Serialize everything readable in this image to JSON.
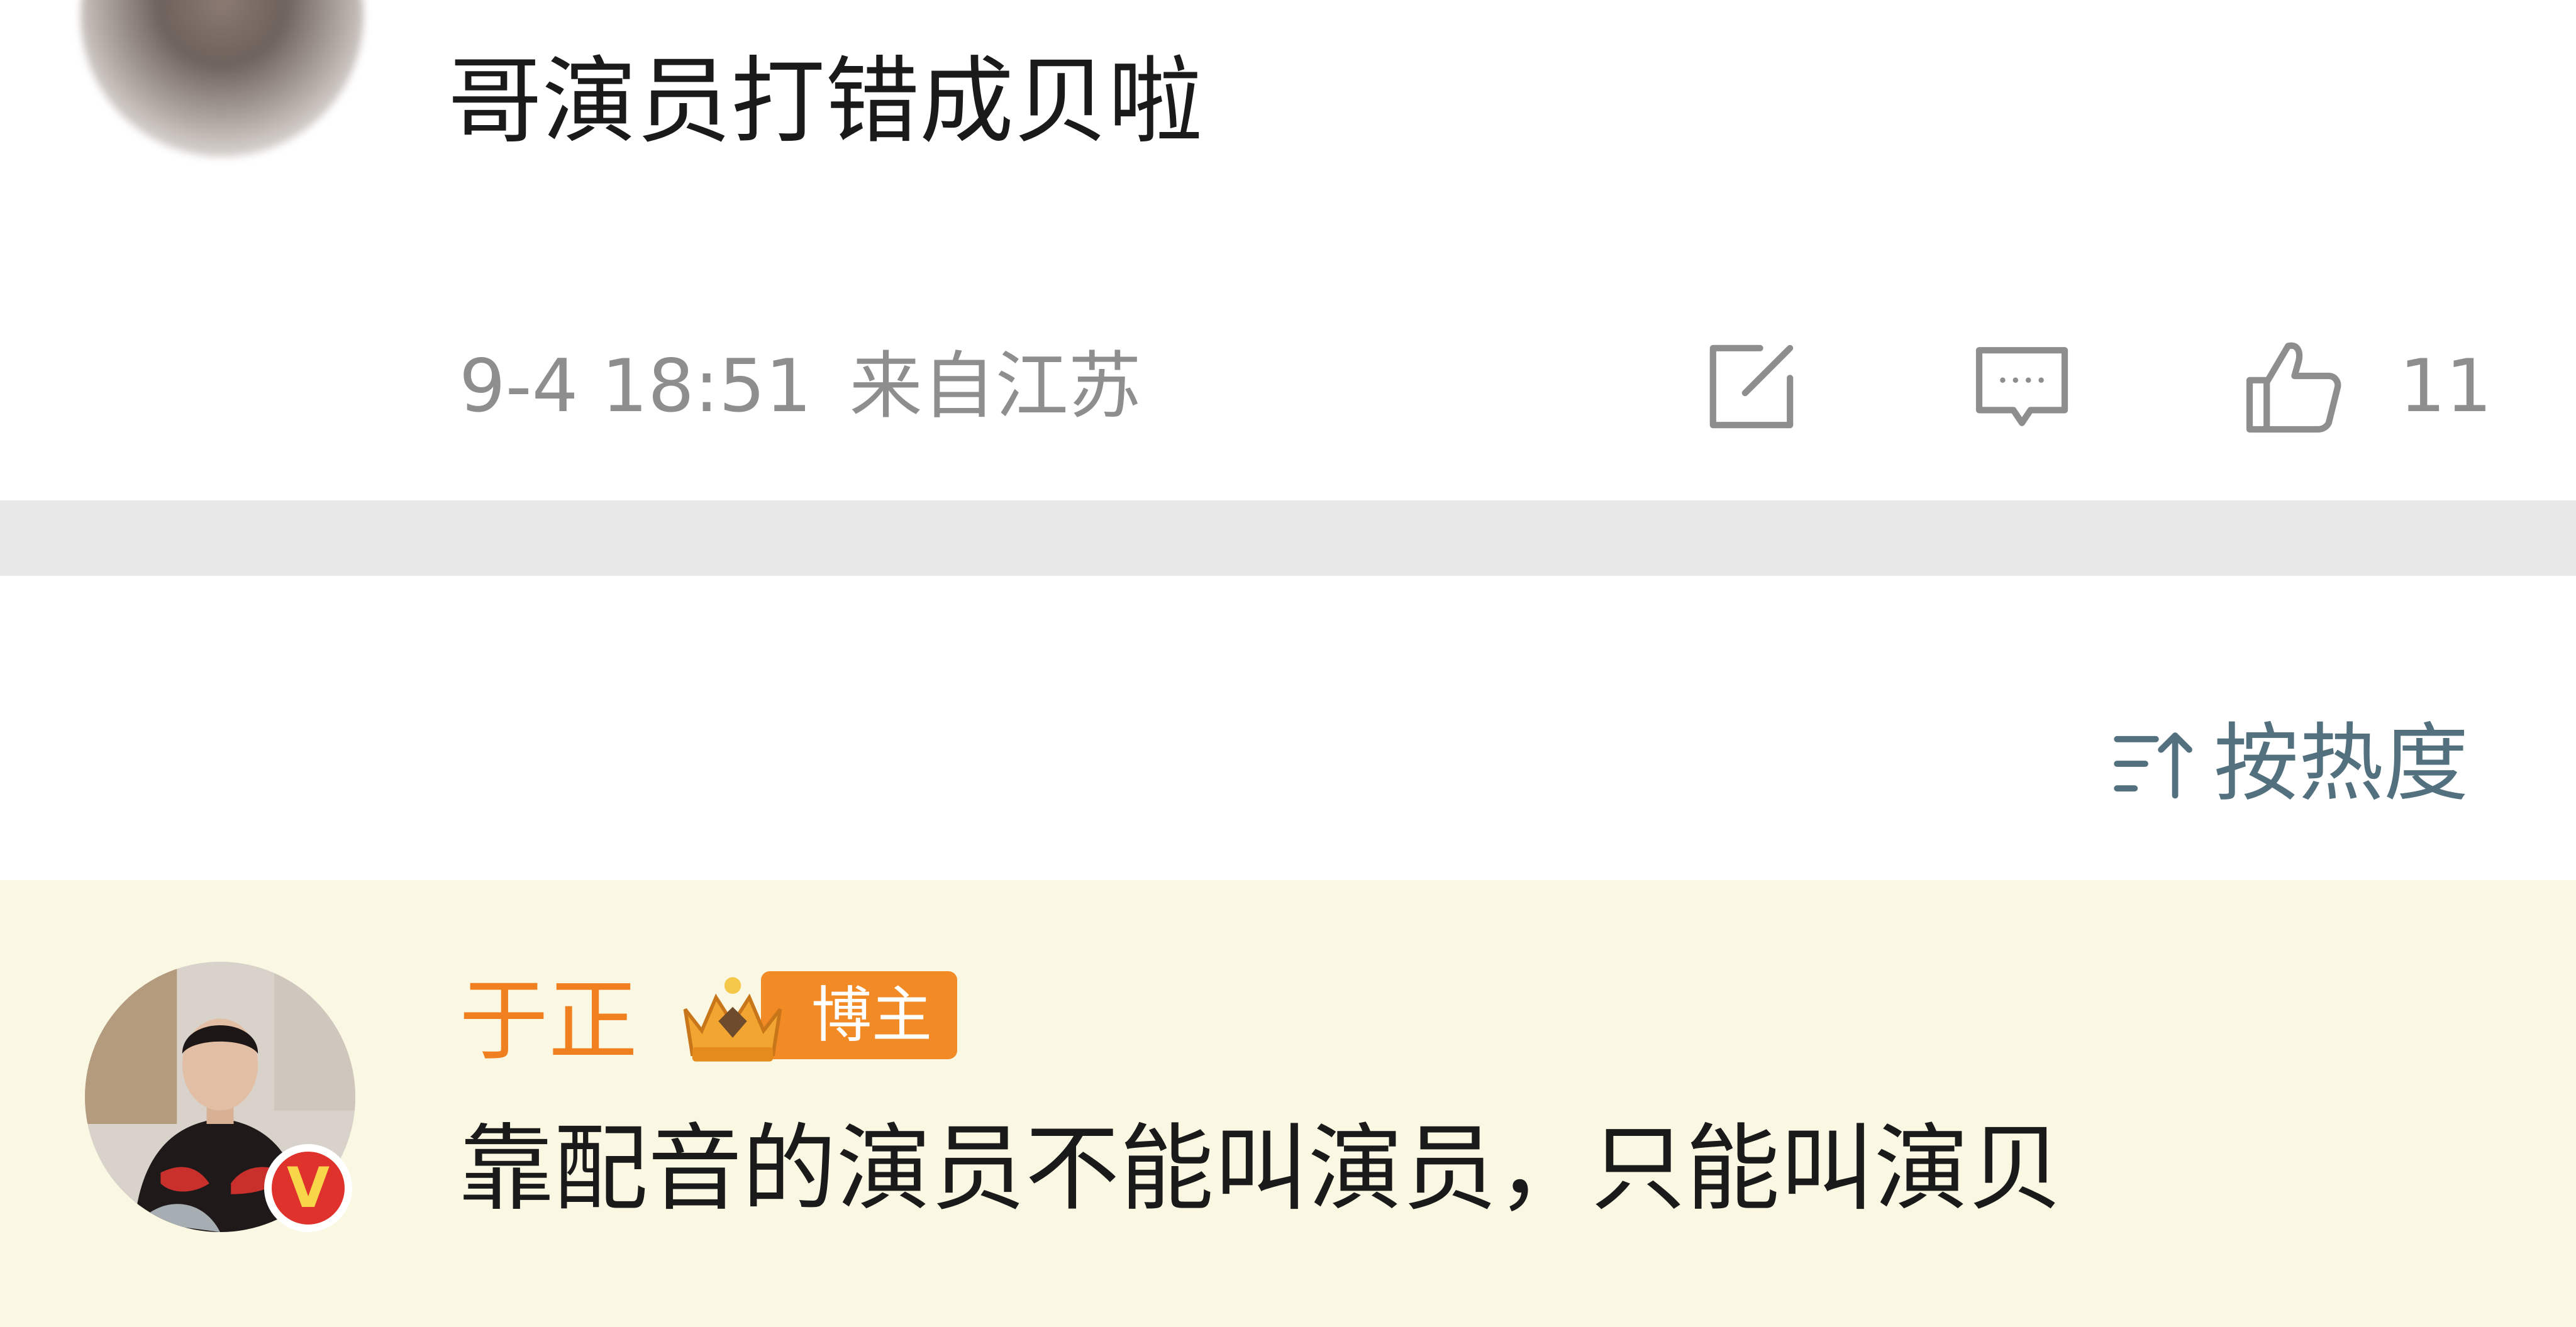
{
  "top_comment": {
    "text": "哥演员打错成贝啦",
    "time": "9-4 18:51",
    "location": "来自江苏",
    "like_count": "11",
    "icons": [
      "share-icon",
      "reply-icon",
      "thumbs-up-icon"
    ]
  },
  "sort": {
    "label": "按热度",
    "icon": "sort-icon"
  },
  "author_reply": {
    "name": "于正",
    "badge_label": "博主",
    "badge_icon": "crown-icon",
    "verified_icon": "verified-v-icon",
    "text": "靠配音的演员不能叫演员，只能叫演贝"
  },
  "colors": {
    "text_primary": "#1a1a1a",
    "text_meta": "#8e8e8e",
    "sort_text": "#53707e",
    "author_name": "#f07f1f",
    "badge_bg": "#f28a25",
    "reply_highlight_bg": "#faf8e2",
    "divider_bg": "#e8e8e8",
    "verified_bg": "#e0322d"
  }
}
